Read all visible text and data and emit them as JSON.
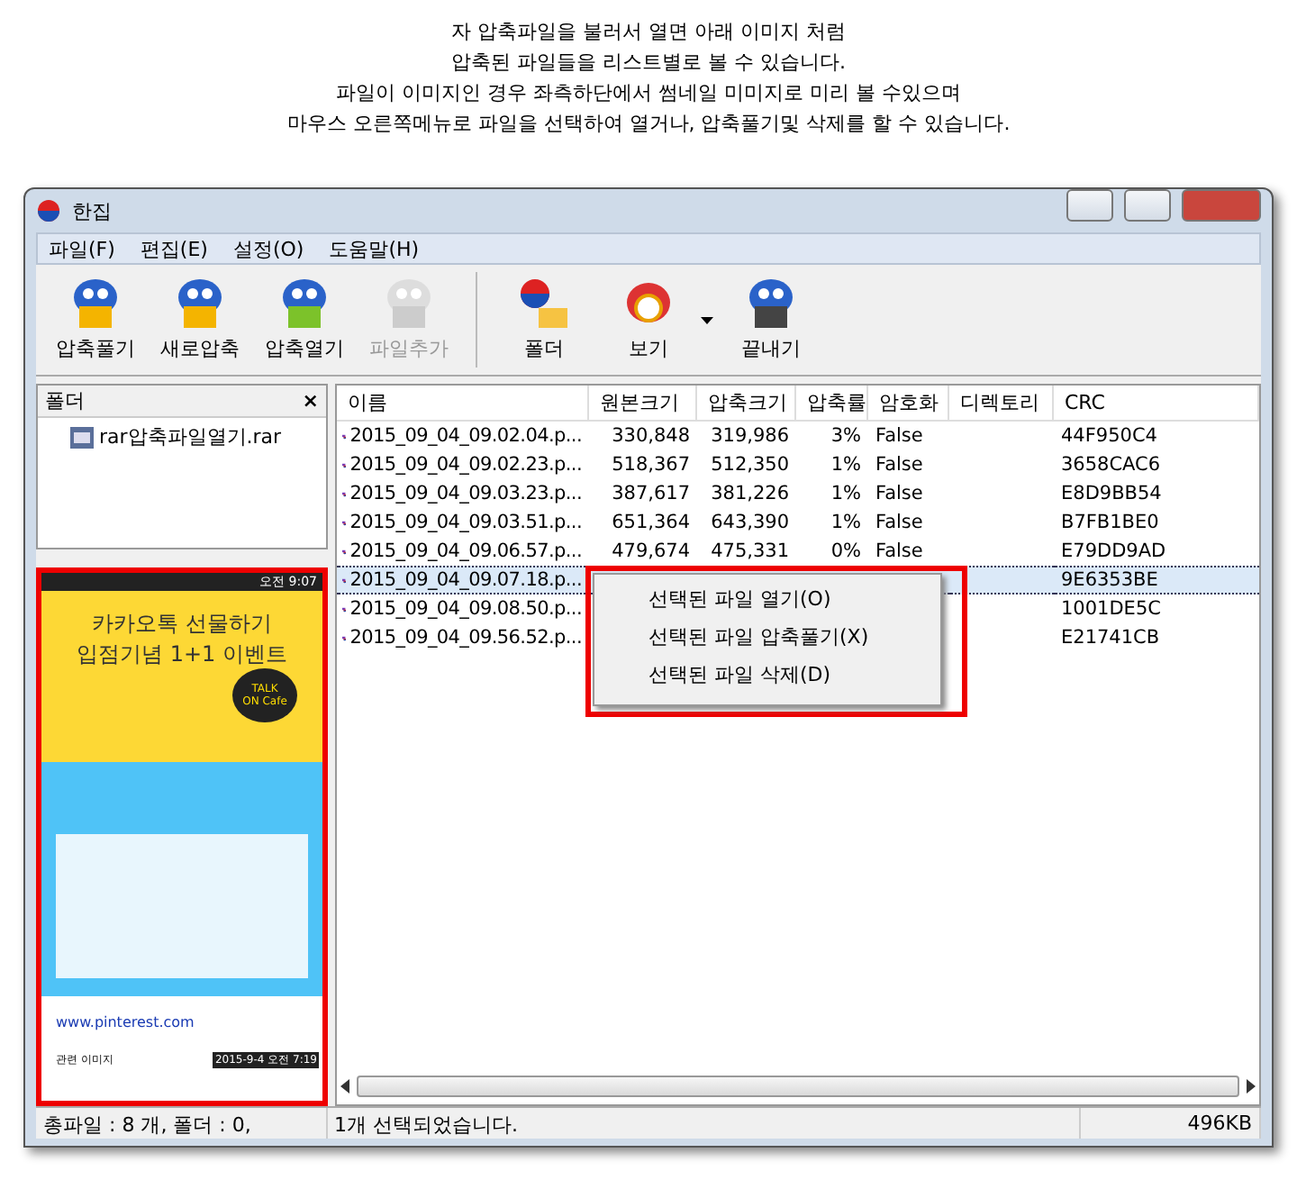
{
  "caption": [
    "자 압축파일을 불러서 열면 아래 이미지 처럼",
    "압축된 파일들을 리스트별로 볼 수 있습니다.",
    "파일이 이미지인 경우 좌측하단에서 썸네일 미미지로 미리 볼 수있으며",
    "마우스 오른쪽메뉴로 파일을 선택하여 열거나, 압축풀기및 삭제를 할 수 있습니다."
  ],
  "window": {
    "title": "한집"
  },
  "menu": [
    "파일(F)",
    "편집(E)",
    "설정(O)",
    "도움말(H)"
  ],
  "toolbar": [
    {
      "label": "압축풀기",
      "kind": "extract",
      "disabled": false
    },
    {
      "label": "새로압축",
      "kind": "new",
      "disabled": false
    },
    {
      "label": "압축열기",
      "kind": "open",
      "disabled": false
    },
    {
      "label": "파일추가",
      "kind": "add",
      "disabled": true
    },
    {
      "label": "폴더",
      "kind": "folder",
      "disabled": false,
      "separator_before": true
    },
    {
      "label": "보기",
      "kind": "view",
      "disabled": false,
      "dropdown": true
    },
    {
      "label": "끝내기",
      "kind": "exit",
      "disabled": false
    }
  ],
  "folder_pane": {
    "title": "폴더",
    "close": "×",
    "tree": [
      {
        "label": "rar압축파일열기.rar"
      }
    ]
  },
  "preview": {
    "status_time": "오전 9:07",
    "headline": "카카오톡 선물하기",
    "subhead": "입점기념 1+1 이벤트",
    "bubble_1": "TALK",
    "bubble_2": "ON Cafe",
    "link": "www.pinterest.com",
    "footer": "관련 이미지",
    "stamp": "2015-9-4 오전 7:19"
  },
  "table": {
    "columns": [
      "이름",
      "원본크기",
      "압축크기",
      "압축률",
      "암호화",
      "디렉토리",
      "CRC"
    ],
    "rows": [
      {
        "name": "2015_09_04_09.02.04.p...",
        "orig": "330,848",
        "comp": "319,986",
        "ratio": "3%",
        "enc": "False",
        "crc": "44F950C4",
        "selected": false
      },
      {
        "name": "2015_09_04_09.02.23.p...",
        "orig": "518,367",
        "comp": "512,350",
        "ratio": "1%",
        "enc": "False",
        "crc": "3658CAC6",
        "selected": false
      },
      {
        "name": "2015_09_04_09.03.23.p...",
        "orig": "387,617",
        "comp": "381,226",
        "ratio": "1%",
        "enc": "False",
        "crc": "E8D9BB54",
        "selected": false
      },
      {
        "name": "2015_09_04_09.03.51.p...",
        "orig": "651,364",
        "comp": "643,390",
        "ratio": "1%",
        "enc": "False",
        "crc": "B7FB1BE0",
        "selected": false
      },
      {
        "name": "2015_09_04_09.06.57.p...",
        "orig": "479,674",
        "comp": "475,331",
        "ratio": "0%",
        "enc": "False",
        "crc": "E79DD9AD",
        "selected": false
      },
      {
        "name": "2015_09_04_09.07.18.p...",
        "crc": "9E6353BE",
        "selected": true
      },
      {
        "name": "2015_09_04_09.08.50.p...",
        "crc": "1001DE5C",
        "selected": false
      },
      {
        "name": "2015_09_04_09.56.52.p...",
        "crc": "E21741CB",
        "selected": false
      }
    ]
  },
  "context_menu": [
    "선택된 파일 열기(O)",
    "선택된 파일 압축풀기(X)",
    "선택된 파일 삭제(D)"
  ],
  "status_bar": {
    "left": "총파일 : 8 개, 폴더 : 0,",
    "middle": "1개 선택되었습니다.",
    "right": "496KB"
  }
}
